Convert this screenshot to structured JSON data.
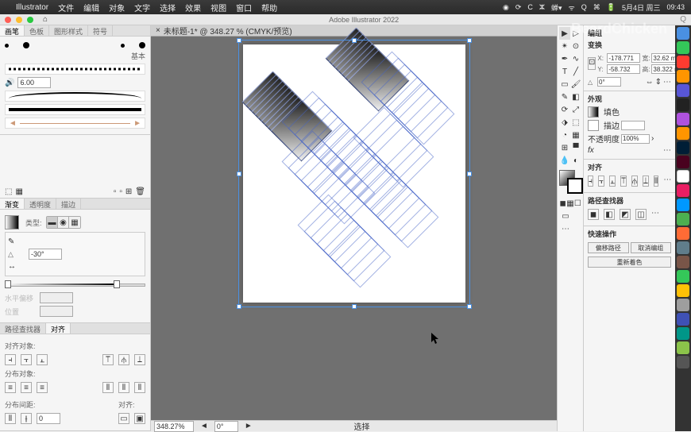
{
  "menubar": {
    "app": "Illustrator",
    "items": [
      "文件",
      "编辑",
      "对象",
      "文字",
      "选择",
      "效果",
      "视图",
      "窗口",
      "帮助"
    ],
    "date": "5月4日 周三",
    "time": "09:43"
  },
  "window": {
    "title": "Adobe Illustrator 2022"
  },
  "document": {
    "tab": "未标题-1* @ 348.27 % (CMYK/预览)",
    "zoom": "348.27%",
    "tool_status": "选择"
  },
  "left": {
    "brush_tabs": [
      "画笔",
      "色板",
      "图形样式",
      "符号"
    ],
    "basic": "基本",
    "ruler_val": "6.00",
    "grad_tabs": [
      "渐变",
      "透明度",
      "描边"
    ],
    "type_label": "类型:",
    "angle_label": "△",
    "angle_val": "-30°",
    "h_off_label": "水平偏移",
    "v_off_label": "位置",
    "pf_tabs": [
      "路径查找器",
      "对齐"
    ],
    "align_obj": "对齐对象:",
    "dist_obj": "分布对象:",
    "dist_space": "分布间距:",
    "align_to": "对齐:"
  },
  "props": {
    "group": "编组",
    "transform": "变换",
    "x_label": "X:",
    "x_val": "-178.771",
    "w_label": "宽:",
    "w_val": "32.62 m",
    "y_label": "Y:",
    "y_val": "-58.732",
    "h_label": "高:",
    "h_val": "38.322 r",
    "rot": "△",
    "rot_val": "0°",
    "appearance": "外观",
    "fill": "填色",
    "stroke": "描边",
    "opacity": "不透明度",
    "opacity_val": "100%",
    "fx": "fx",
    "align": "对齐",
    "pathfinder": "路径查找器",
    "quick": "快速操作",
    "offset": "偏移路径",
    "ungroup": "取消编组",
    "recolor": "重新着色"
  },
  "watermark": "BeardChicken",
  "status": {
    "rot": "0°",
    "sel": "选择"
  }
}
